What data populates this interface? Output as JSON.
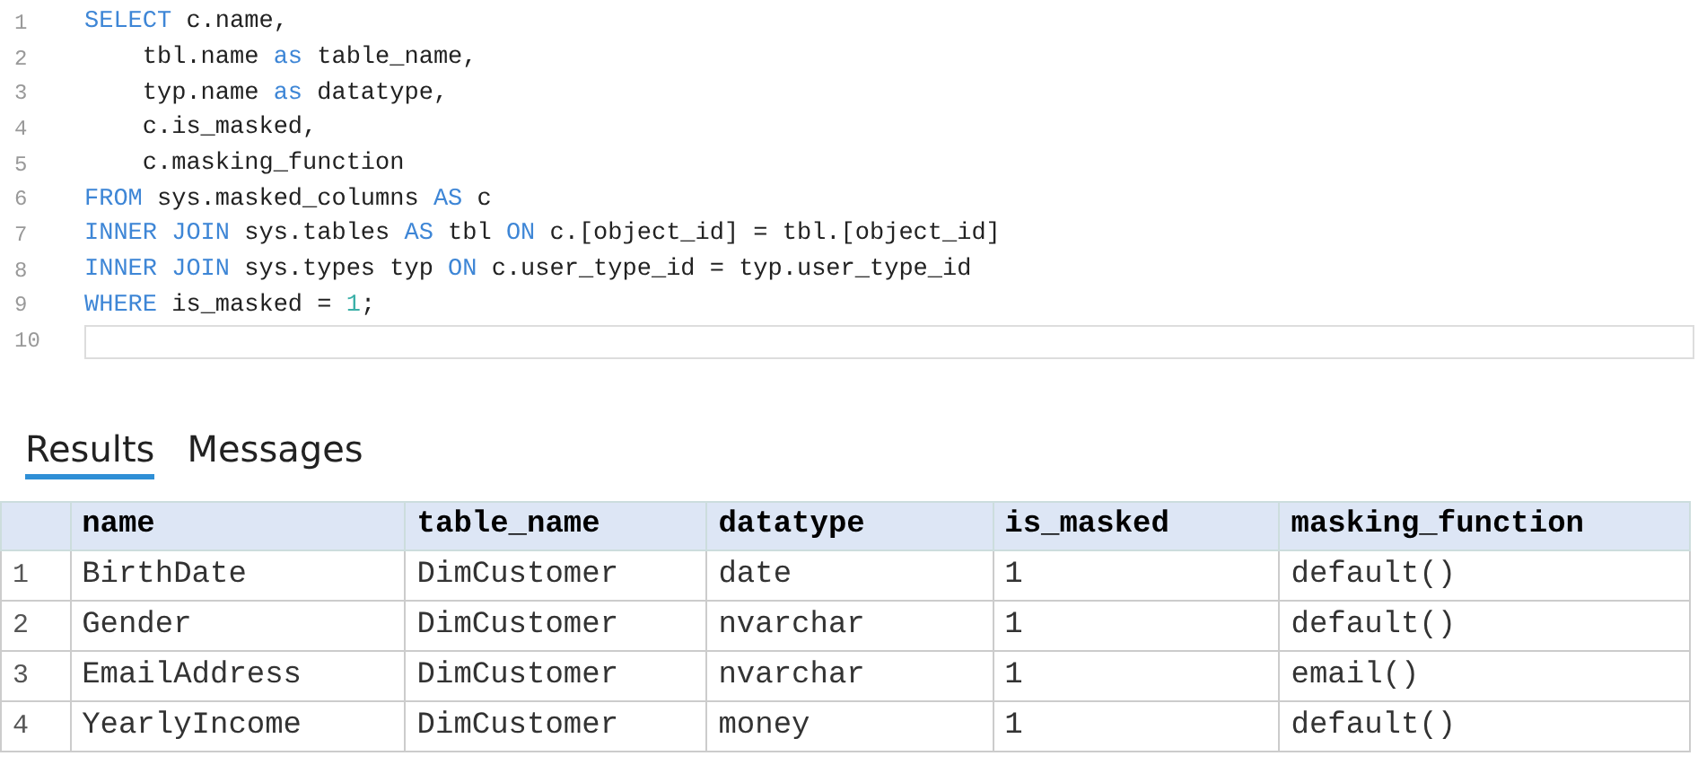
{
  "editor": {
    "lines": [
      {
        "number": "1",
        "current": false,
        "parts": [
          {
            "text": "SELECT",
            "kind": "keyword"
          },
          {
            "text": " c.name,",
            "kind": "plain"
          }
        ]
      },
      {
        "number": "2",
        "current": false,
        "parts": [
          {
            "text": "    tbl.name ",
            "kind": "plain"
          },
          {
            "text": "as",
            "kind": "keyword"
          },
          {
            "text": " table_name,",
            "kind": "plain"
          }
        ]
      },
      {
        "number": "3",
        "current": false,
        "parts": [
          {
            "text": "    typ.name ",
            "kind": "plain"
          },
          {
            "text": "as",
            "kind": "keyword"
          },
          {
            "text": " datatype,",
            "kind": "plain"
          }
        ]
      },
      {
        "number": "4",
        "current": false,
        "parts": [
          {
            "text": "    c.is_masked,",
            "kind": "plain"
          }
        ]
      },
      {
        "number": "5",
        "current": false,
        "parts": [
          {
            "text": "    c.masking_function",
            "kind": "plain"
          }
        ]
      },
      {
        "number": "6",
        "current": false,
        "parts": [
          {
            "text": "FROM",
            "kind": "keyword"
          },
          {
            "text": " sys.masked_columns ",
            "kind": "plain"
          },
          {
            "text": "AS",
            "kind": "keyword"
          },
          {
            "text": " c",
            "kind": "plain"
          }
        ]
      },
      {
        "number": "7",
        "current": false,
        "parts": [
          {
            "text": "INNER JOIN",
            "kind": "keyword"
          },
          {
            "text": " sys.tables ",
            "kind": "plain"
          },
          {
            "text": "AS",
            "kind": "keyword"
          },
          {
            "text": " tbl ",
            "kind": "plain"
          },
          {
            "text": "ON",
            "kind": "keyword"
          },
          {
            "text": " c.[object_id] = tbl.[object_id]",
            "kind": "plain"
          }
        ]
      },
      {
        "number": "8",
        "current": false,
        "parts": [
          {
            "text": "INNER JOIN",
            "kind": "keyword"
          },
          {
            "text": " sys.types typ ",
            "kind": "plain"
          },
          {
            "text": "ON",
            "kind": "keyword"
          },
          {
            "text": " c.user_type_id = typ.user_type_id",
            "kind": "plain"
          }
        ]
      },
      {
        "number": "9",
        "current": false,
        "parts": [
          {
            "text": "WHERE",
            "kind": "keyword"
          },
          {
            "text": " is_masked = ",
            "kind": "plain"
          },
          {
            "text": "1",
            "kind": "number"
          },
          {
            "text": ";",
            "kind": "plain"
          }
        ]
      },
      {
        "number": "10",
        "current": true
      }
    ]
  },
  "tabs": [
    {
      "label": "Results",
      "selected": true
    },
    {
      "label": "Messages",
      "selected": false
    }
  ],
  "table": {
    "columns": [
      "name",
      "table_name",
      "datatype",
      "is_masked",
      "masking_function"
    ],
    "rows": [
      {
        "number": "1",
        "cells": [
          "BirthDate",
          "DimCustomer",
          "date",
          "1",
          "default()"
        ]
      },
      {
        "number": "2",
        "cells": [
          "Gender",
          "DimCustomer",
          "nvarchar",
          "1",
          "default()"
        ]
      },
      {
        "number": "3",
        "cells": [
          "EmailAddress",
          "DimCustomer",
          "nvarchar",
          "1",
          "email()"
        ]
      },
      {
        "number": "4",
        "cells": [
          "YearlyIncome",
          "DimCustomer",
          "money",
          "1",
          "default()"
        ]
      }
    ]
  }
}
